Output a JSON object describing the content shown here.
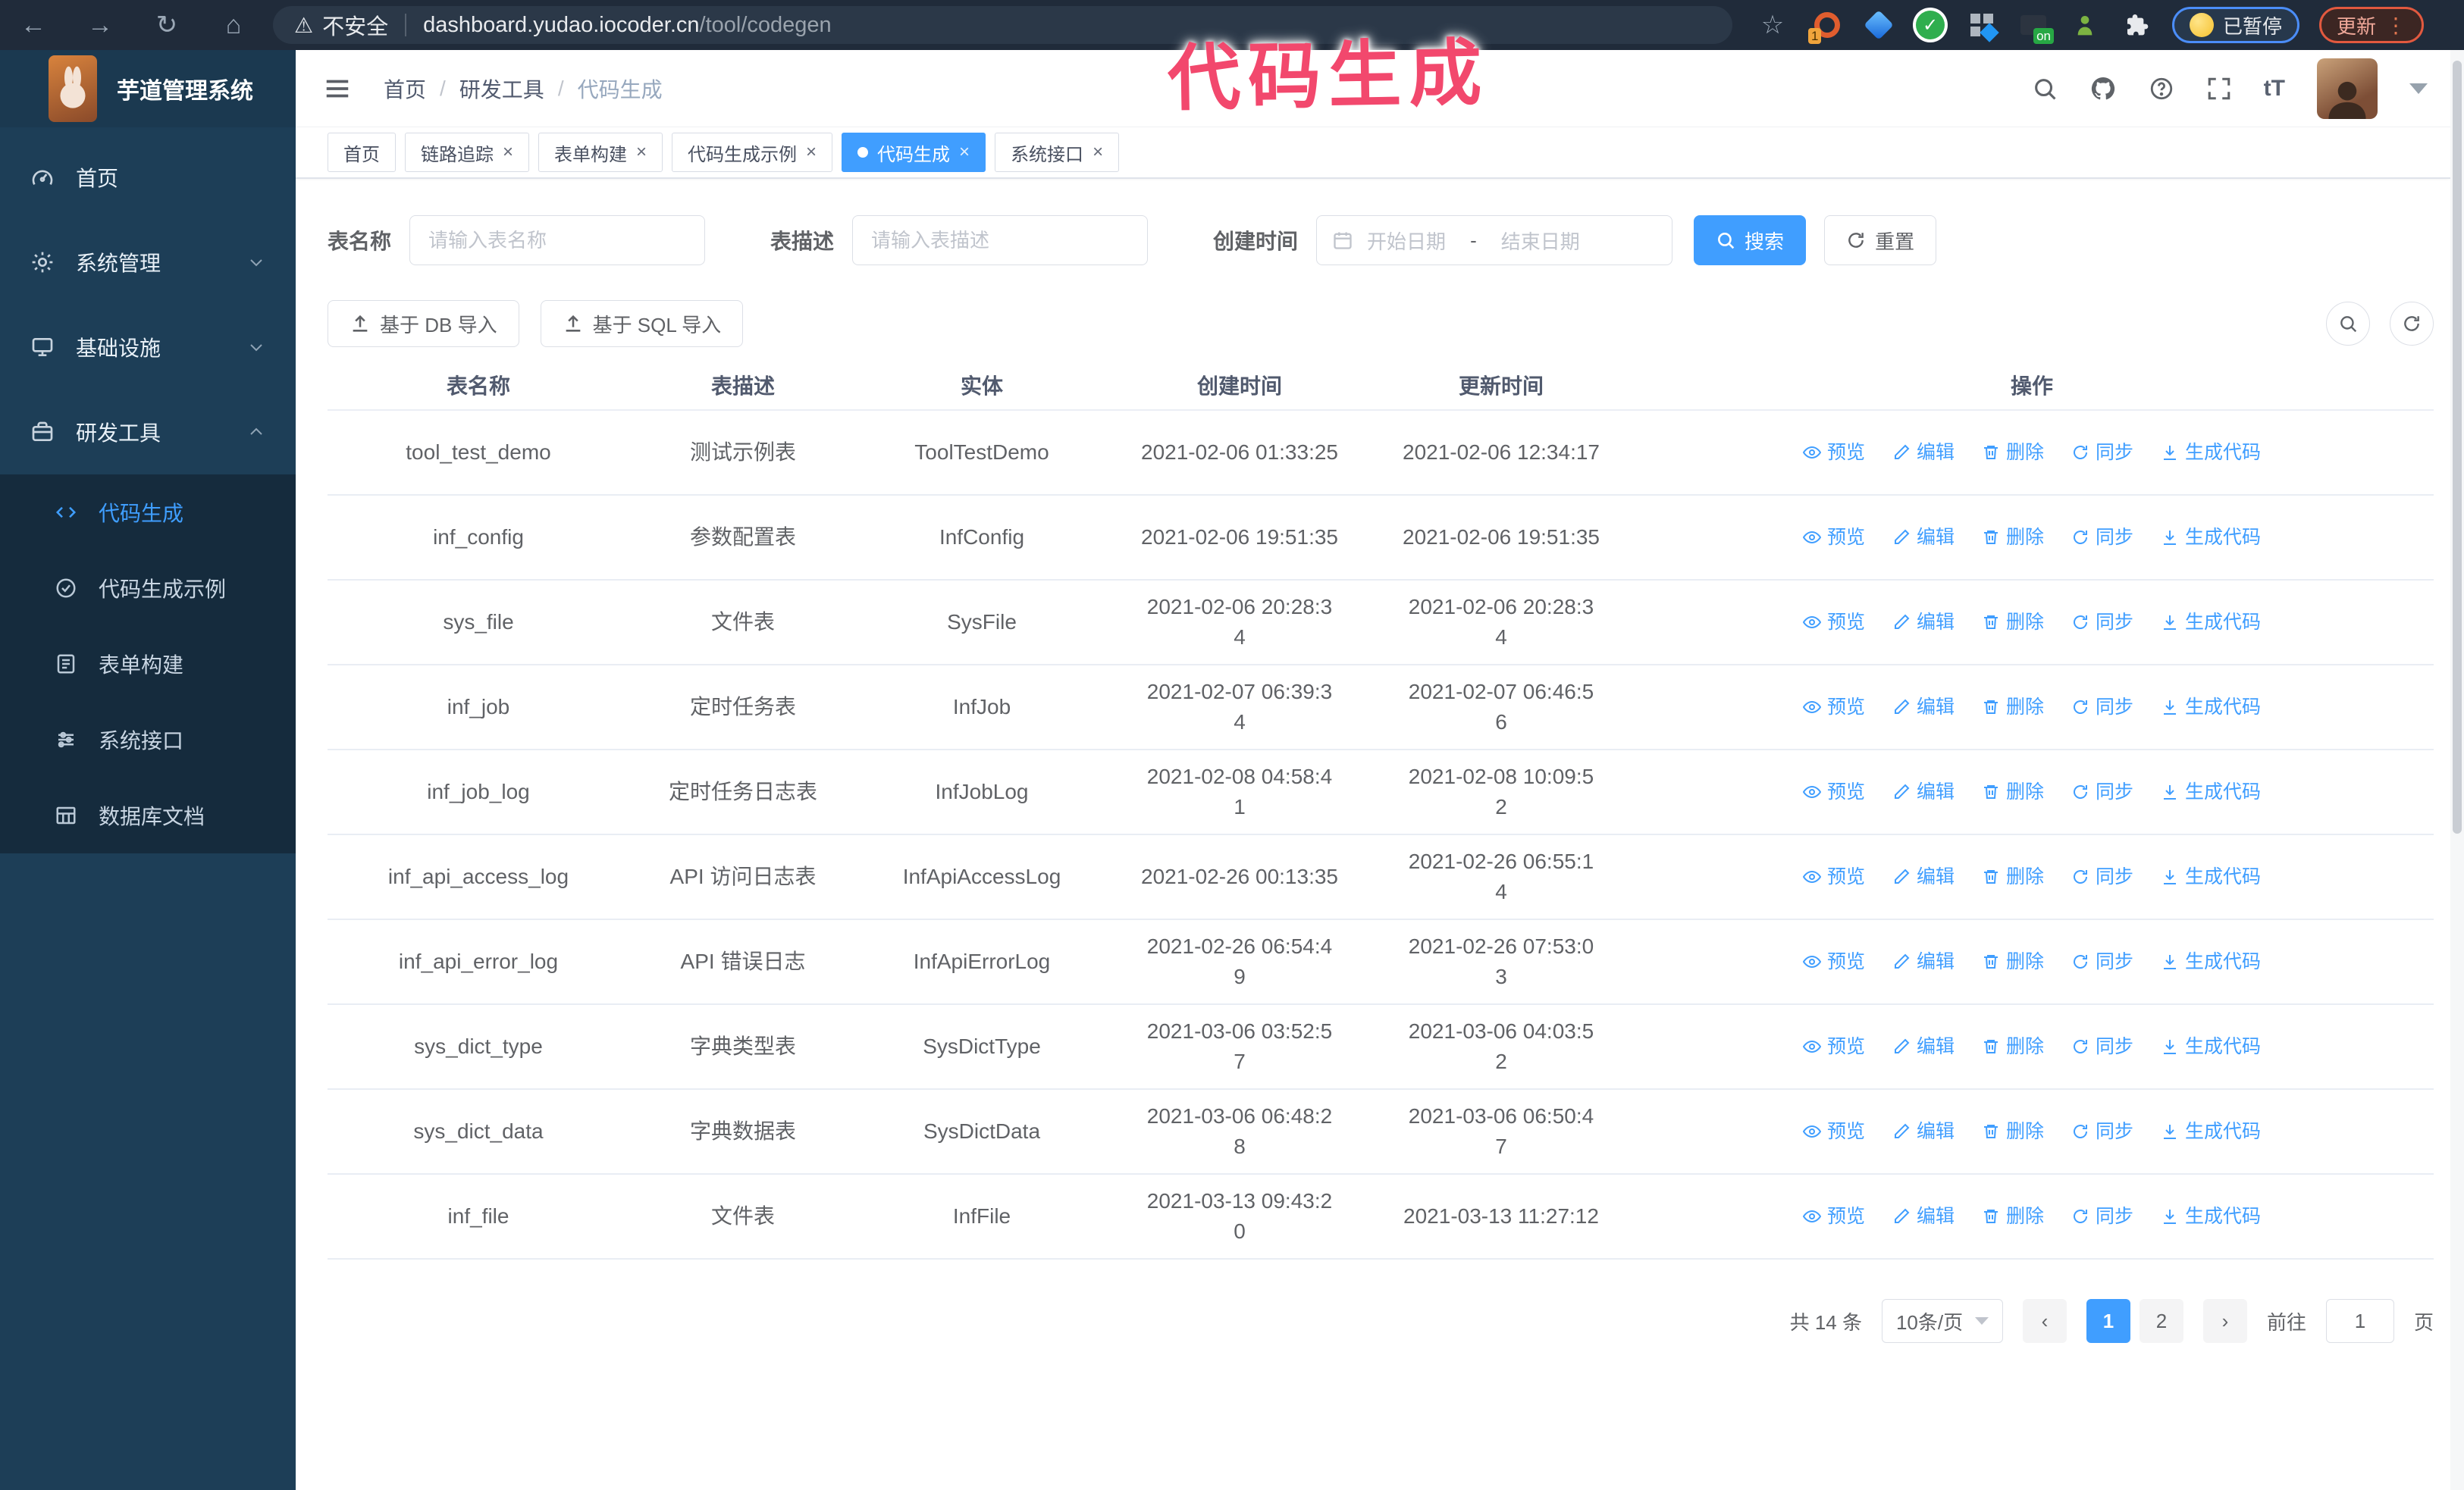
{
  "browser": {
    "security_label": "不安全",
    "url_domain": "dashboard.yudao.iocoder.cn",
    "url_path": "/tool/codegen",
    "ext_badge_1": "1",
    "ext_badge_on": "on",
    "paused_badge": "已暂停",
    "update_button": "更新"
  },
  "annotation": {
    "text": "代码生成",
    "color": "#f2486d"
  },
  "app": {
    "title": "芋道管理系统"
  },
  "breadcrumb": {
    "items": [
      "首页",
      "研发工具",
      "代码生成"
    ]
  },
  "sidebar": {
    "items": [
      {
        "label": "首页",
        "icon": "dashboard",
        "expandable": false,
        "expanded": false
      },
      {
        "label": "系统管理",
        "icon": "gear",
        "expandable": true,
        "expanded": false
      },
      {
        "label": "基础设施",
        "icon": "infra",
        "expandable": true,
        "expanded": false
      },
      {
        "label": "研发工具",
        "icon": "tools",
        "expandable": true,
        "expanded": true
      }
    ],
    "submenu": [
      {
        "label": "代码生成",
        "icon": "code",
        "active": true
      },
      {
        "label": "代码生成示例",
        "icon": "example",
        "active": false
      },
      {
        "label": "表单构建",
        "icon": "form",
        "active": false
      },
      {
        "label": "系统接口",
        "icon": "api",
        "active": false
      },
      {
        "label": "数据库文档",
        "icon": "dbdoc",
        "active": false
      }
    ]
  },
  "tabsbar": {
    "tabs": [
      {
        "label": "首页",
        "closable": false,
        "active": false
      },
      {
        "label": "链路追踪",
        "closable": true,
        "active": false
      },
      {
        "label": "表单构建",
        "closable": true,
        "active": false
      },
      {
        "label": "代码生成示例",
        "closable": true,
        "active": false
      },
      {
        "label": "代码生成",
        "closable": true,
        "active": true
      },
      {
        "label": "系统接口",
        "closable": true,
        "active": false
      }
    ]
  },
  "search": {
    "name_label": "表名称",
    "name_placeholder": "请输入表名称",
    "desc_label": "表描述",
    "desc_placeholder": "请输入表描述",
    "time_label": "创建时间",
    "start_placeholder": "开始日期",
    "range_separator": "-",
    "end_placeholder": "结束日期",
    "search_button": "搜索",
    "reset_button": "重置"
  },
  "toolbar": {
    "import_db": "基于 DB 导入",
    "import_sql": "基于 SQL 导入"
  },
  "table": {
    "columns": [
      "表名称",
      "表描述",
      "实体",
      "创建时间",
      "更新时间",
      "操作"
    ],
    "actions": [
      {
        "label": "预览",
        "icon": "eye"
      },
      {
        "label": "编辑",
        "icon": "pen"
      },
      {
        "label": "删除",
        "icon": "trash"
      },
      {
        "label": "同步",
        "icon": "sync"
      },
      {
        "label": "生成代码",
        "icon": "download"
      }
    ],
    "rows": [
      {
        "name": "tool_test_demo",
        "desc": "测试示例表",
        "entity": "ToolTestDemo",
        "created": "2021-02-06 01:33:25",
        "updated": "2021-02-06 12:34:17"
      },
      {
        "name": "inf_config",
        "desc": "参数配置表",
        "entity": "InfConfig",
        "created": "2021-02-06 19:51:35",
        "updated": "2021-02-06 19:51:35"
      },
      {
        "name": "sys_file",
        "desc": "文件表",
        "entity": "SysFile",
        "created": "2021-02-06 20:28:3\n4",
        "updated": "2021-02-06 20:28:3\n4"
      },
      {
        "name": "inf_job",
        "desc": "定时任务表",
        "entity": "InfJob",
        "created": "2021-02-07 06:39:3\n4",
        "updated": "2021-02-07 06:46:5\n6"
      },
      {
        "name": "inf_job_log",
        "desc": "定时任务日志表",
        "entity": "InfJobLog",
        "created": "2021-02-08 04:58:4\n1",
        "updated": "2021-02-08 10:09:5\n2"
      },
      {
        "name": "inf_api_access_log",
        "desc": "API 访问日志表",
        "entity": "InfApiAccessLog",
        "created": "2021-02-26 00:13:35",
        "updated": "2021-02-26 06:55:1\n4"
      },
      {
        "name": "inf_api_error_log",
        "desc": "API 错误日志",
        "entity": "InfApiErrorLog",
        "created": "2021-02-26 06:54:4\n9",
        "updated": "2021-02-26 07:53:0\n3"
      },
      {
        "name": "sys_dict_type",
        "desc": "字典类型表",
        "entity": "SysDictType",
        "created": "2021-03-06 03:52:5\n7",
        "updated": "2021-03-06 04:03:5\n2"
      },
      {
        "name": "sys_dict_data",
        "desc": "字典数据表",
        "entity": "SysDictData",
        "created": "2021-03-06 06:48:2\n8",
        "updated": "2021-03-06 06:50:4\n7"
      },
      {
        "name": "inf_file",
        "desc": "文件表",
        "entity": "InfFile",
        "created": "2021-03-13 09:43:2\n0",
        "updated": "2021-03-13 11:27:12"
      }
    ]
  },
  "pagination": {
    "total": "共 14 条",
    "page_size": "10条/页",
    "pages": [
      {
        "label": "1",
        "active": true
      },
      {
        "label": "2",
        "active": false
      }
    ],
    "goto_label": "前往",
    "goto_value": "1",
    "page_suffix": "页"
  },
  "colors": {
    "accent": "#409eff",
    "sidebar_bg": "#1d3e57",
    "submenu_bg": "#152b3d",
    "browser_bar": "#202b3a",
    "annotation": "#f2486d"
  }
}
